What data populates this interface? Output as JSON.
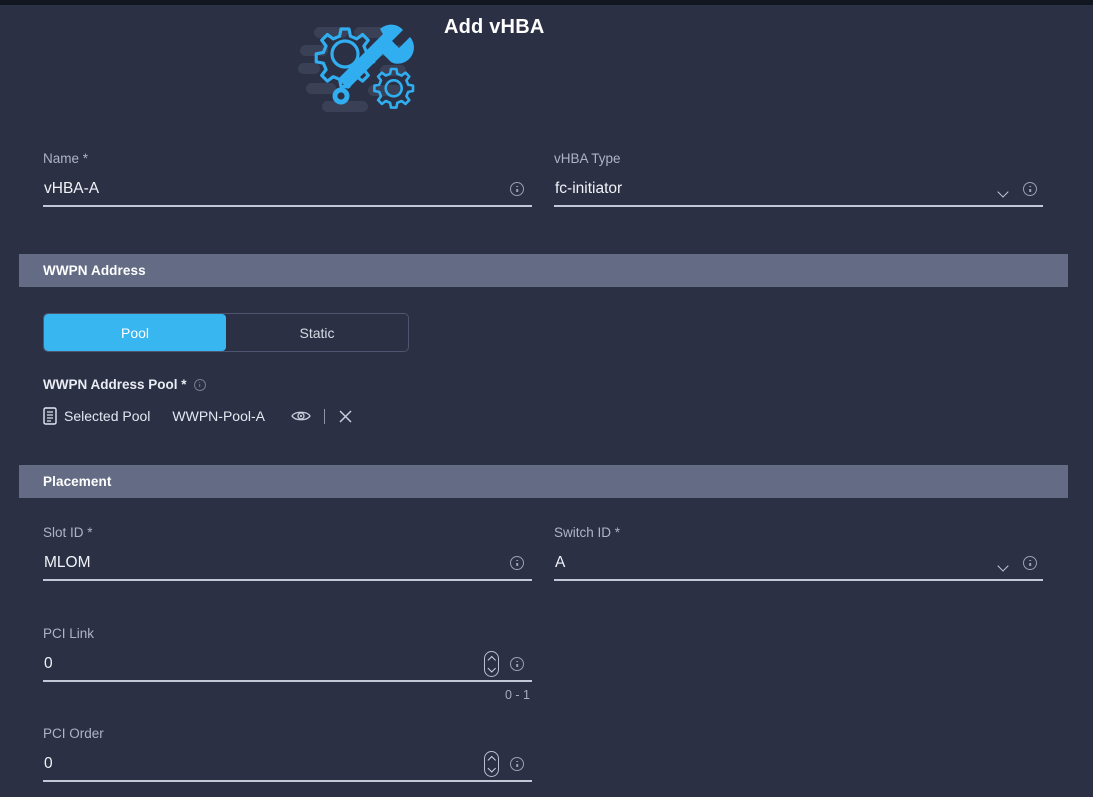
{
  "dialog": {
    "title": "Add vHBA",
    "hero_icon": "gear-wrench-icon"
  },
  "fields": {
    "name": {
      "label": "Name *",
      "value": "vHBA-A",
      "info_icon": "info-icon"
    },
    "vhba_type": {
      "label": "vHBA Type",
      "value": "fc-initiator",
      "chevron_icon": "chevron-down-icon",
      "info_icon": "info-icon"
    },
    "slot_id": {
      "label": "Slot ID *",
      "value": "MLOM",
      "info_icon": "info-icon"
    },
    "switch_id": {
      "label": "Switch ID *",
      "value": "A",
      "chevron_icon": "chevron-down-icon",
      "info_icon": "info-icon"
    },
    "pci_link": {
      "label": "PCI Link",
      "value": "0",
      "hint": "0 - 1",
      "stepper_icon": "stepper-icon",
      "info_icon": "info-icon"
    },
    "pci_order": {
      "label": "PCI Order",
      "value": "0",
      "hint": "",
      "stepper_icon": "stepper-icon",
      "info_icon": "info-icon"
    }
  },
  "sections": {
    "wwpn_address": {
      "title": "WWPN Address"
    },
    "placement": {
      "title": "Placement"
    }
  },
  "wwpn": {
    "toggle": {
      "options": [
        {
          "label": "Pool",
          "active": true
        },
        {
          "label": "Static",
          "active": false
        }
      ]
    },
    "pool_field_label": "WWPN Address Pool *",
    "pool_field_info_icon": "info-icon",
    "selected": {
      "doc_icon": "document-icon",
      "caption": "Selected Pool",
      "name": "WWPN-Pool-A",
      "view_icon": "eye-icon",
      "clear_icon": "close-icon"
    }
  },
  "colors": {
    "background": "#2b3044",
    "top_strip": "#12161f",
    "section_bar": "#646c85",
    "accent": "#37b6f0",
    "underline": "#c3c8d6",
    "label_text": "#aeb4c4"
  }
}
